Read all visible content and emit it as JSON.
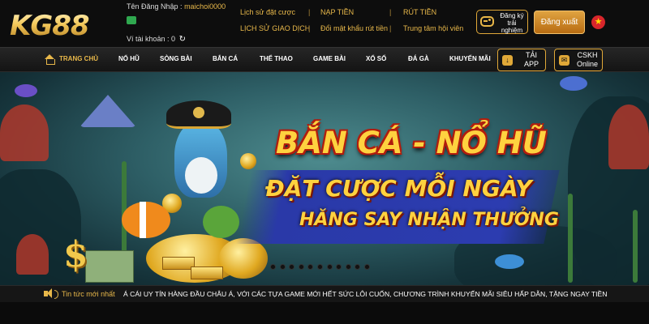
{
  "header": {
    "logo": "KG88",
    "account": {
      "username_label": "Tên Đăng Nhập :",
      "username": "maichoi0000",
      "wallet_label": "Ví tài khoản : 0"
    },
    "links": [
      {
        "label": "Lịch sử đặt cược"
      },
      {
        "label": "NẠP TIỀN"
      },
      {
        "label": "RÚT TIỀN"
      },
      {
        "label": "LỊCH SỬ GIAO DỊCH"
      },
      {
        "label": "Đổi mật khẩu rút tiền"
      },
      {
        "label": "Trung tâm hội viên"
      }
    ],
    "register_trial_label": "Đăng ký trải nghiệm",
    "logout_label": "Đăng xuất",
    "flag": "vietnam-flag-icon"
  },
  "nav": {
    "items": [
      {
        "label": "TRANG CHỦ",
        "active": true
      },
      {
        "label": "NỔ HŨ"
      },
      {
        "label": "SÒNG BÀI"
      },
      {
        "label": "BẮN CÁ"
      },
      {
        "label": "THỂ THAO"
      },
      {
        "label": "GAME BÀI"
      },
      {
        "label": "XỔ SỐ"
      },
      {
        "label": "ĐÁ GÀ"
      },
      {
        "label": "KHUYẾN MÃI"
      }
    ],
    "app_button": {
      "line1": "TẢI",
      "line2": "APP"
    },
    "support_button": {
      "line1": "CSKH",
      "line2": "Online"
    }
  },
  "banner": {
    "title": "BẮN CÁ - NỔ HŨ",
    "line1": "ĐẶT CƯỢC MỖI NGÀY",
    "line2": "HĂNG SAY NHẬN THƯỞNG",
    "slide_count": 11
  },
  "ticker": {
    "label": "Tin tức mới nhất",
    "text": "Á CÁI UY TÍN HÀNG ĐẦU CHÂU Á, VỚI CÁC TỰA GAME MỚI HẾT SỨC LÔI CUỐN, CHƯƠNG TRÌNH KHUYẾN MÃI SIÊU HẤP DẪN, TẶNG NGAY TIỀN THƯỞ!"
  },
  "colors": {
    "gold": "#e8b84a",
    "background": "#0d0d0d",
    "banner_blue": "#2c3cb0"
  }
}
